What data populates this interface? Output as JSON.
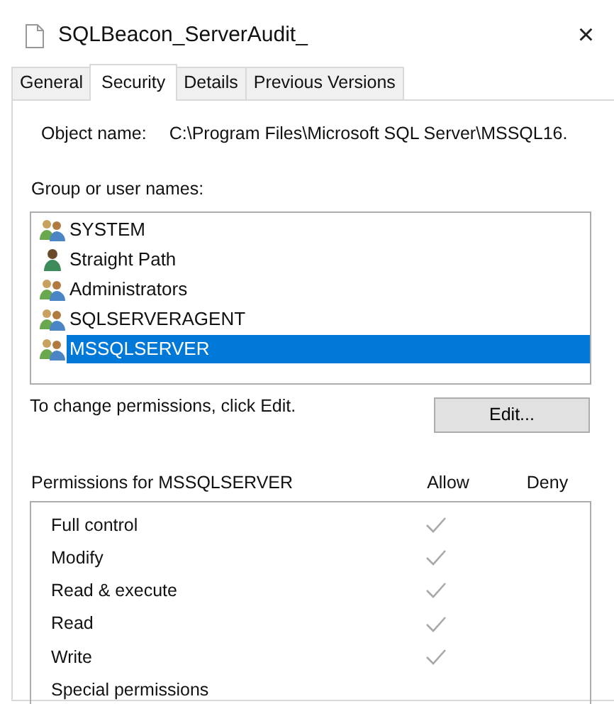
{
  "window": {
    "title": "SQLBeacon_ServerAudit_",
    "close": "×"
  },
  "tabs": [
    {
      "label": "General",
      "selected": false
    },
    {
      "label": "Security",
      "selected": true
    },
    {
      "label": "Details",
      "selected": false
    },
    {
      "label": "Previous Versions",
      "selected": false
    }
  ],
  "object_name": {
    "label": "Object name:",
    "value": "C:\\Program Files\\Microsoft SQL Server\\MSSQL16."
  },
  "users": {
    "label": "Group or user names:",
    "items": [
      {
        "name": "SYSTEM",
        "kind": "group",
        "selected": false
      },
      {
        "name": "Straight Path",
        "kind": "user",
        "selected": false
      },
      {
        "name": "Administrators",
        "kind": "group",
        "selected": false
      },
      {
        "name": "SQLSERVERAGENT",
        "kind": "group",
        "selected": false
      },
      {
        "name": "MSSQLSERVER",
        "kind": "group",
        "selected": true
      }
    ]
  },
  "hint": "To change permissions, click Edit.",
  "edit_button": "Edit...",
  "permissions": {
    "title": "Permissions for MSSQLSERVER",
    "columns": [
      "Allow",
      "Deny"
    ],
    "rows": [
      {
        "name": "Full control",
        "allow": true,
        "deny": false
      },
      {
        "name": "Modify",
        "allow": true,
        "deny": false
      },
      {
        "name": "Read & execute",
        "allow": true,
        "deny": false
      },
      {
        "name": "Read",
        "allow": true,
        "deny": false
      },
      {
        "name": "Write",
        "allow": true,
        "deny": false
      },
      {
        "name": "Special permissions",
        "allow": false,
        "deny": false
      }
    ]
  }
}
